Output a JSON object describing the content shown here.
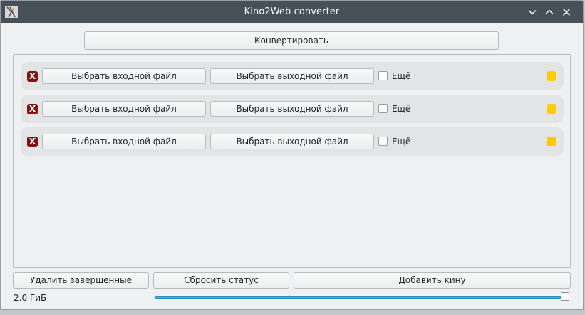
{
  "window": {
    "title": "Kino2Web converter",
    "app_icon": "kino2web-app-icon",
    "controls": [
      "minimize-chevron-down-icon",
      "maximize-chevron-up-icon",
      "close-icon"
    ]
  },
  "toolbar": {
    "convert_label": "Конвертировать"
  },
  "jobs": [
    {
      "remove_symbol": "X",
      "input_label": "Выбрать входной файл",
      "output_label": "Выбрать выходной файл",
      "more_label": "Ещё",
      "more_checked": false,
      "status_color": "#ffcc00"
    },
    {
      "remove_symbol": "X",
      "input_label": "Выбрать входной файл",
      "output_label": "Выбрать выходной файл",
      "more_label": "Ещё",
      "more_checked": false,
      "status_color": "#ffcc00"
    },
    {
      "remove_symbol": "X",
      "input_label": "Выбрать входной файл",
      "output_label": "Выбрать выходной файл",
      "more_label": "Ещё",
      "more_checked": false,
      "status_color": "#ffcc00"
    }
  ],
  "footer": {
    "remove_finished_label": "Удалить завершенные",
    "reset_status_label": "Сбросить статус",
    "add_job_label": "Добавить кину",
    "size_label": "2.0 ГиБ",
    "size_slider_fraction": 1.0
  },
  "colors": {
    "titlebar": "#475057",
    "accent": "#3daee9",
    "remove": "#7c1612",
    "status_pending": "#ffcc00"
  }
}
